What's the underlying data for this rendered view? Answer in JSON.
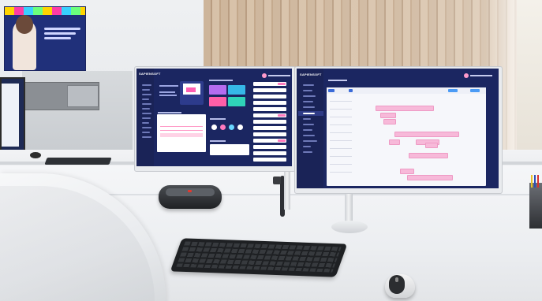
{
  "scene": {
    "monitor_left": {
      "brand_logo": "SAPIENSOFT"
    },
    "monitor_right": {
      "brand_logo": "SAPIENSOFT"
    }
  },
  "colors": {
    "screen_navy": "#1b2661",
    "accent_pink": "#ff7abf",
    "wood": "#c9ae92",
    "desk": "#eef0f2"
  },
  "icons": [
    "speaker",
    "keyboard",
    "mouse",
    "monitor"
  ]
}
